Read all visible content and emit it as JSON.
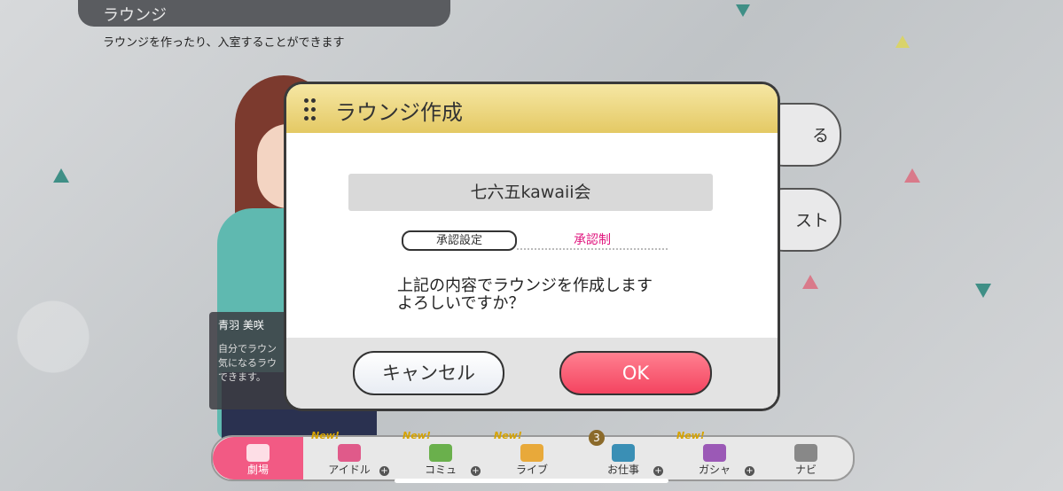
{
  "header": {
    "title": "ラウンジ",
    "subtitle": "ラウンジを作ったり、入室することができます"
  },
  "side_buttons": [
    {
      "label": "る"
    },
    {
      "label": "スト"
    }
  ],
  "character_info": {
    "name": "青羽 美咲",
    "lines": [
      "自分でラウン",
      "気になるラウ",
      "できます。"
    ]
  },
  "dialog": {
    "title": "ラウンジ作成",
    "lounge_name": "七六五kawaii会",
    "approval_label": "承認設定",
    "approval_value": "承認制",
    "confirm_line1": "上記の内容でラウンジを作成します",
    "confirm_line2": "よろしいですか？",
    "cancel_label": "キャンセル",
    "ok_label": "OK"
  },
  "nav": {
    "items": [
      {
        "label": "劇場"
      },
      {
        "label": "アイドル",
        "badge": "New!"
      },
      {
        "label": "コミュ",
        "badge": "New!"
      },
      {
        "label": "ライブ",
        "badge": "New!"
      },
      {
        "label": "お仕事",
        "count": "3"
      },
      {
        "label": "ガシャ",
        "badge": "New!"
      },
      {
        "label": "ナビ"
      }
    ]
  },
  "colors": {
    "dialog_header": "#e4c964",
    "ok_button": "#f44460",
    "approval_value": "#e0157e",
    "theater_tab": "#f25a84"
  }
}
